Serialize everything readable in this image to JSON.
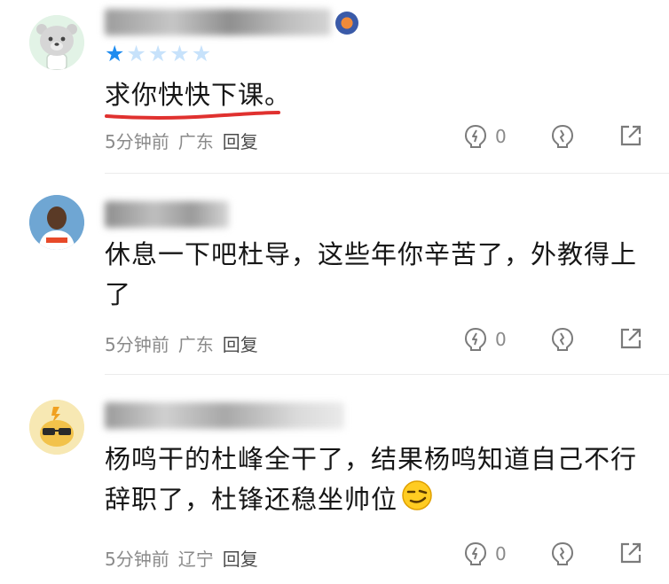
{
  "comments": [
    {
      "rating": 1,
      "text": "求你快快下课。",
      "time": "5分钟前",
      "location": "广东",
      "reply_label": "回复",
      "likes": "0",
      "avatar_icon": "bear-avatar-icon"
    },
    {
      "text": "休息一下吧杜导，这些年你辛苦了，外教得上了",
      "time": "5分钟前",
      "location": "广东",
      "reply_label": "回复",
      "likes": "0",
      "avatar_icon": "basketball-player-avatar"
    },
    {
      "text": "杨鸣干的杜峰全干了，结果杨鸣知道自己不行辞职了，杜锋还稳坐帅位",
      "emoji": "smirk-emoji-icon",
      "time": "5分钟前",
      "location": "辽宁",
      "reply_label": "回复",
      "likes": "0",
      "avatar_icon": "sunglasses-mascot-avatar"
    }
  ],
  "colors": {
    "star_on": "#1e8cf0",
    "star_off": "#c7e2fb",
    "underline": "#e0312f",
    "meta": "#8a8a8a"
  }
}
